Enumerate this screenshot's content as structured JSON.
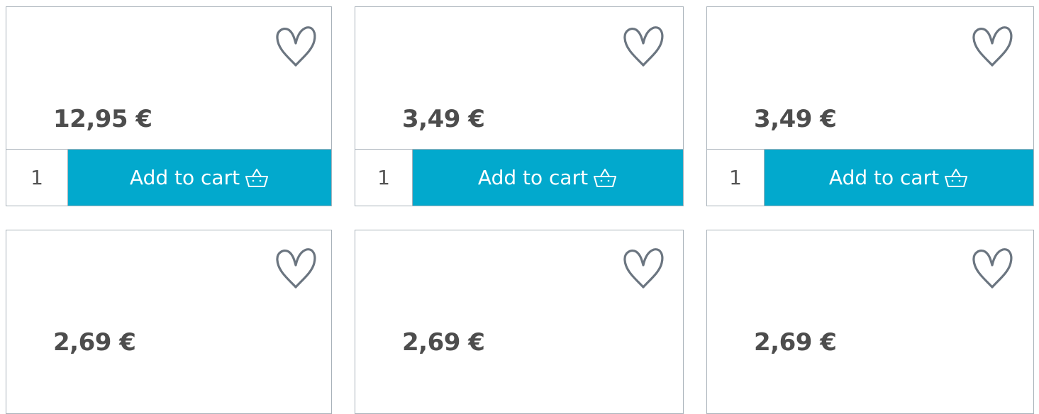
{
  "colors": {
    "accent": "#02a9cd",
    "border": "#a9b2ba",
    "price_text": "#4d4d4d",
    "heart_stroke": "#6b7580"
  },
  "icons": {
    "favorite": "heart-outline-icon",
    "cart": "basket-icon"
  },
  "products": [
    {
      "price": "12,95 €",
      "quantity": "1",
      "add_label": "Add to cart"
    },
    {
      "price": "3,49 €",
      "quantity": "1",
      "add_label": "Add to cart"
    },
    {
      "price": "3,49 €",
      "quantity": "1",
      "add_label": "Add to cart"
    },
    {
      "price": "2,69 €"
    },
    {
      "price": "2,69 €"
    },
    {
      "price": "2,69 €"
    }
  ]
}
